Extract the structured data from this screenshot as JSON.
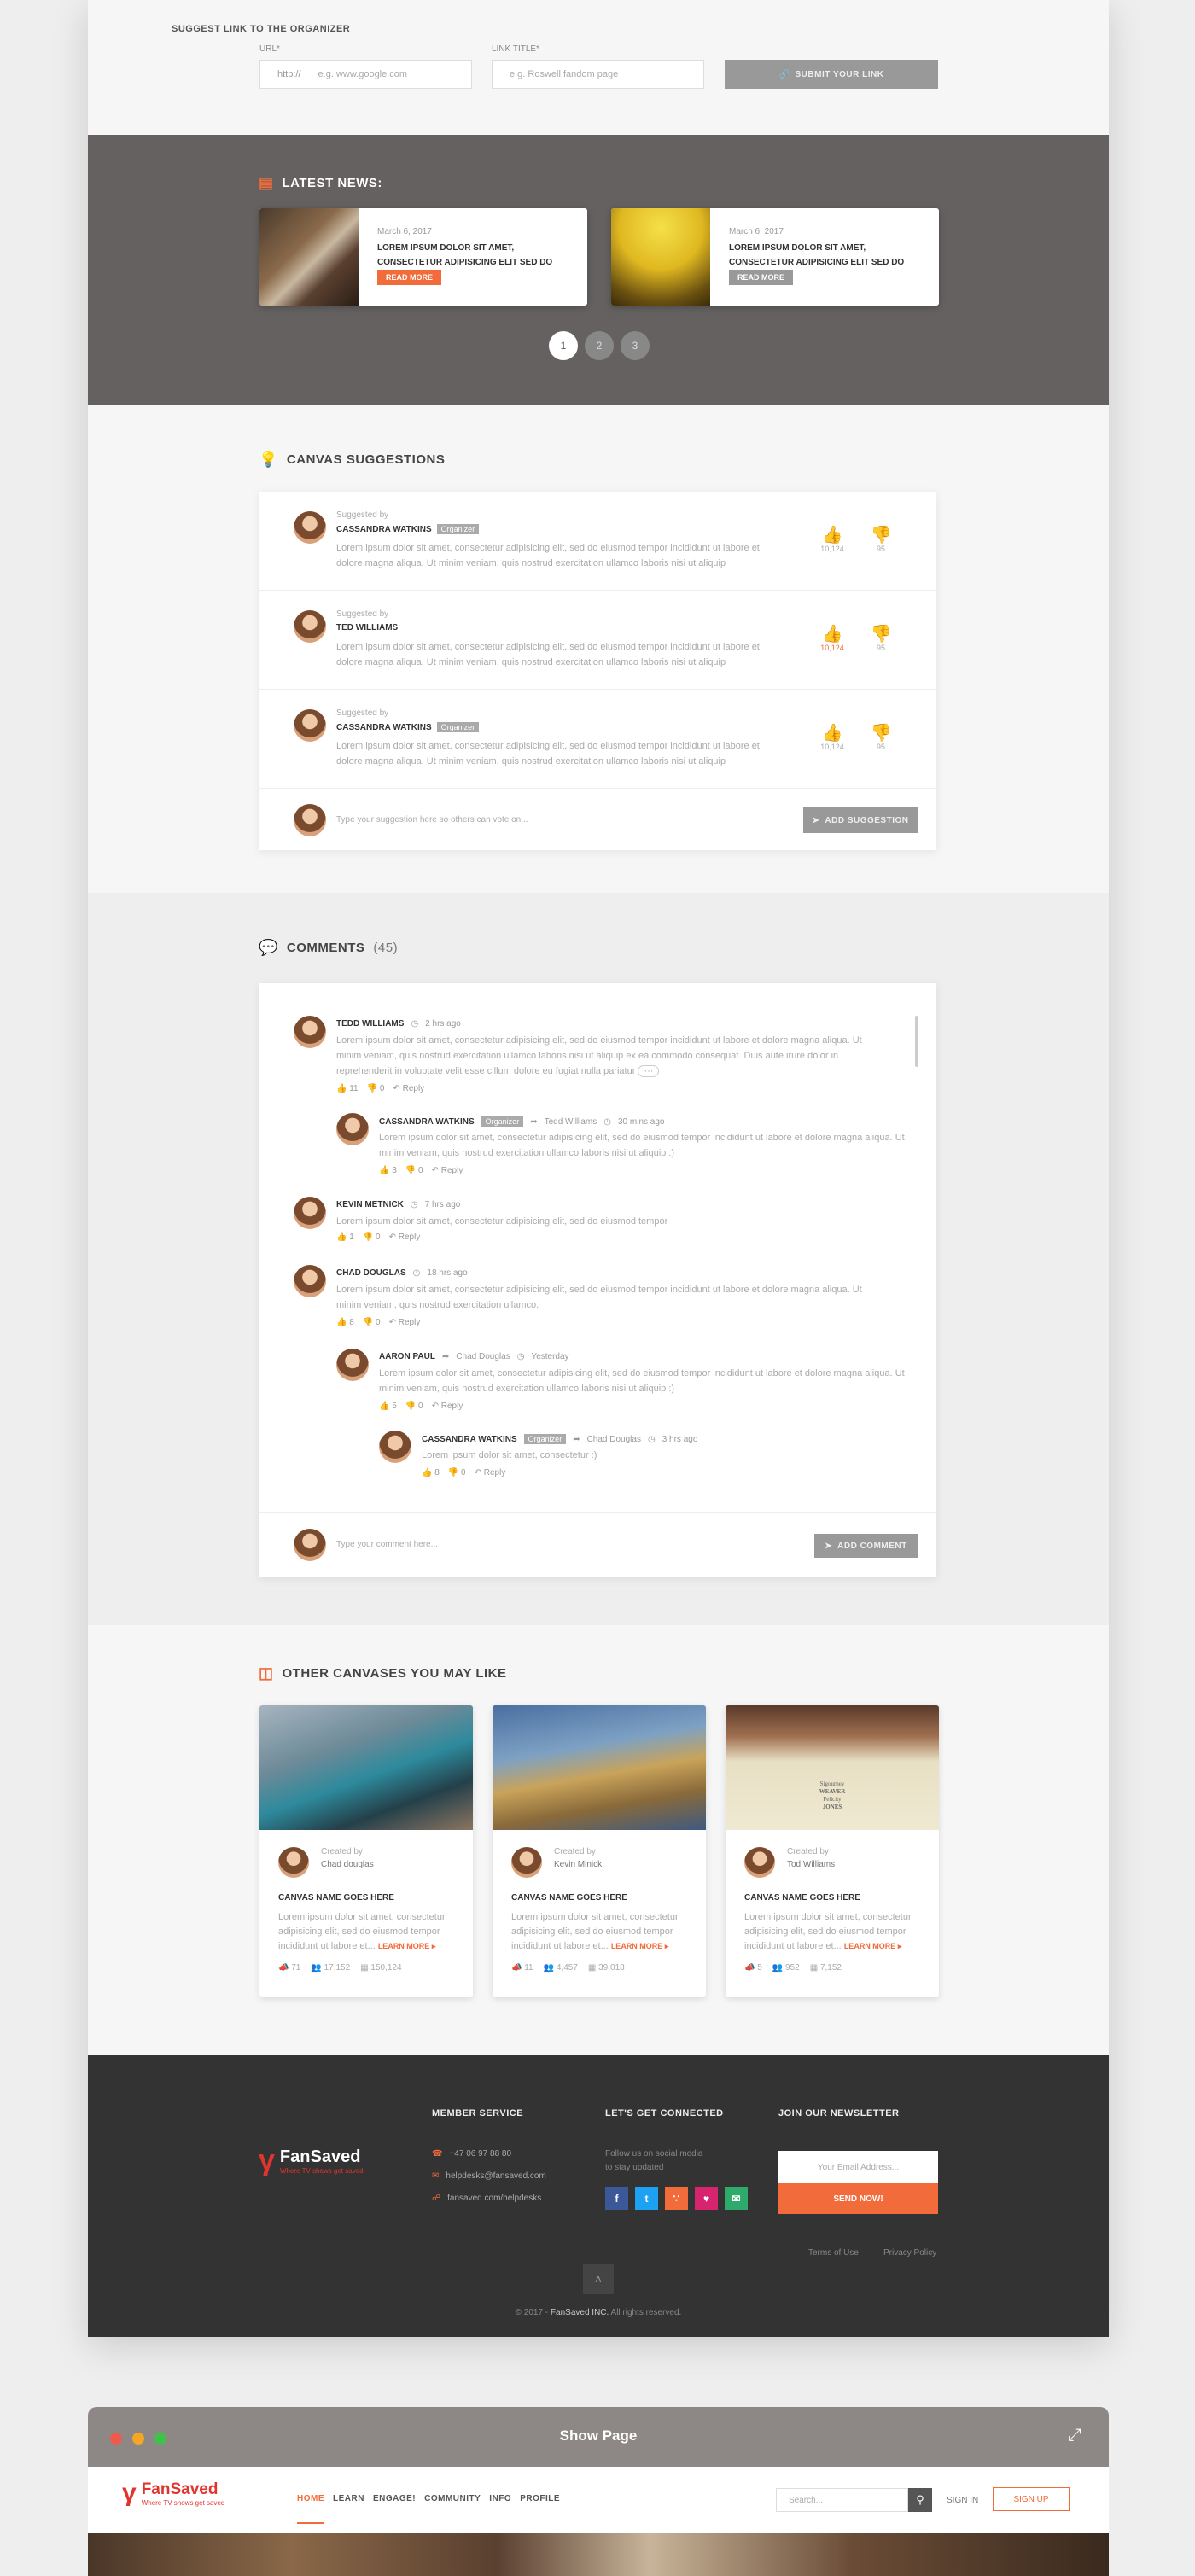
{
  "suggest_link": {
    "title": "SUGGEST LINK TO THE ORGANIZER",
    "url_label": "URL*",
    "url_prefix": "http://",
    "url_placeholder": "e.g. www.google.com",
    "title_label": "LINK TITLE*",
    "title_placeholder": "e.g. Roswell fandom page",
    "submit_label": "SUBMIT YOUR LINK"
  },
  "latest_news": {
    "heading": "LATEST NEWS:",
    "cards": [
      {
        "date": "March 6, 2017",
        "title": "LOREM IPSUM DOLOR SIT AMET, CONSECTETUR ADIPISICING ELIT SED DO",
        "button": "READ MORE",
        "button_color": "#f26b3a"
      },
      {
        "date": "March 6, 2017",
        "title": "LOREM IPSUM DOLOR SIT AMET, CONSECTETUR ADIPISICING ELIT SED DO",
        "button": "READ MORE",
        "button_color": "#999999"
      }
    ],
    "pages": [
      "1",
      "2",
      "3"
    ],
    "active_page": "1"
  },
  "canvas_suggestions": {
    "heading": "CANVAS SUGGESTIONS",
    "items": [
      {
        "suggested_by": "Suggested by",
        "name": "CASSANDRA WATKINS",
        "badge": "Organizer",
        "text": "Lorem ipsum dolor sit amet, consectetur adipisicing elit, sed do eiusmod tempor incididunt ut labore et dolore magna aliqua. Ut minim veniam, quis nostrud exercitation ullamco laboris nisi ut aliquip",
        "up": "10,124",
        "down": "95",
        "up_active": false
      },
      {
        "suggested_by": "Suggested by",
        "name": "TED WILLIAMS",
        "badge": "",
        "text": "Lorem ipsum dolor sit amet, consectetur adipisicing elit, sed do eiusmod tempor incididunt ut labore et dolore magna aliqua. Ut minim veniam, quis nostrud exercitation ullamco laboris nisi ut aliquip",
        "up": "10,124",
        "down": "95",
        "up_active": true
      },
      {
        "suggested_by": "Suggested by",
        "name": "CASSANDRA WATKINS",
        "badge": "Organizer",
        "text": "Lorem ipsum dolor sit amet, consectetur adipisicing elit, sed do eiusmod tempor incididunt ut labore et dolore magna aliqua. Ut minim veniam, quis nostrud exercitation ullamco laboris nisi ut aliquip",
        "up": "10,124",
        "down": "95",
        "up_active": false
      }
    ],
    "input_placeholder": "Type your suggestion here so others can vote on...",
    "add_label": "ADD SUGGESTION"
  },
  "comments": {
    "heading": "COMMENTS",
    "count": "(45)",
    "items": [
      {
        "name": "TEDD WILLIAMS",
        "time": "2 hrs ago",
        "text1": "Lorem ipsum dolor sit amet, consectetur adipisicing elit, sed do eiusmod tempor incididunt ut labore et dolore magna aliqua. Ut",
        "text2": "minim veniam, quis nostrud exercitation ullamco laboris nisi ut aliquip ex ea commodo consequat. Duis aute irure dolor in",
        "text3": "reprehenderit in voluptate velit esse cillum dolore eu fugiat nulla pariatur",
        "up": "11",
        "down": "0",
        "reply": "Reply"
      },
      {
        "name": "CASSANDRA WATKINS",
        "badge": "Organizer",
        "to": "Tedd Williams",
        "time": "30 mins ago",
        "text1": "Lorem ipsum dolor sit amet, consectetur adipisicing elit, sed do eiusmod tempor incididunt ut labore et dolore magna aliqua. Ut",
        "text2": "minim veniam, quis nostrud exercitation ullamco laboris nisi ut aliquip :)",
        "up": "3",
        "down": "0",
        "reply": "Reply"
      },
      {
        "name": "KEVIN METNICK",
        "time": "7 hrs ago",
        "text1": "Lorem ipsum dolor sit amet, consectetur adipisicing elit, sed do eiusmod tempor",
        "up": "1",
        "down": "0",
        "reply": "Reply"
      },
      {
        "name": "CHAD DOUGLAS",
        "time": "18 hrs ago",
        "text1": "Lorem ipsum dolor sit amet, consectetur adipisicing elit, sed do eiusmod tempor incididunt ut labore et dolore magna aliqua. Ut",
        "text2": "minim veniam, quis nostrud exercitation ullamco.",
        "up": "8",
        "down": "0",
        "reply": "Reply"
      },
      {
        "name": "AARON PAUL",
        "to": "Chad Douglas",
        "time": "Yesterday",
        "text1": "Lorem ipsum dolor sit amet, consectetur adipisicing elit, sed do eiusmod tempor incididunt ut labore et dolore magna aliqua. Ut",
        "text2": "minim veniam, quis nostrud exercitation ullamco laboris nisi ut aliquip :)",
        "up": "5",
        "down": "0",
        "reply": "Reply"
      },
      {
        "name": "CASSANDRA WATKINS",
        "badge": "Organizer",
        "to": "Chad Douglas",
        "time": "3 hrs ago",
        "text1": "Lorem ipsum dolor sit amet, consectetur :)",
        "up": "8",
        "down": "0",
        "reply": "Reply"
      }
    ],
    "input_placeholder": "Type your comment here...",
    "add_label": "ADD COMMENT"
  },
  "other_canvases": {
    "heading": "OTHER CANVASES YOU MAY LIKE",
    "items": [
      {
        "created_by": "Created by",
        "creator": "Chad douglas",
        "title": "CANVAS NAME GOES HERE",
        "desc": "Lorem ipsum dolor sit amet, consectetur adipisicing elit, sed do eiusmod tempor incididunt ut labore et...",
        "learn": "LEARN MORE",
        "s1": "71",
        "s2": "17,152",
        "s3": "150,124"
      },
      {
        "created_by": "Created by",
        "creator": "Kevin Minick",
        "title": "CANVAS NAME GOES HERE",
        "desc": "Lorem ipsum dolor sit amet, consectetur adipisicing elit, sed do eiusmod tempor incididunt ut labore et...",
        "learn": "LEARN MORE",
        "s1": "11",
        "s2": "4,457",
        "s3": "39,018"
      },
      {
        "created_by": "Created by",
        "creator": "Tod Williams",
        "title": "CANVAS NAME GOES HERE",
        "desc": "Lorem ipsum dolor sit amet, consectetur adipisicing elit, sed do eiusmod tempor incididunt ut labore et...",
        "learn": "LEARN MORE",
        "s1": "5",
        "s2": "952",
        "s3": "7,152"
      }
    ],
    "poster_lines": [
      "Sigourney",
      "WEAVER",
      "Felicity",
      "JONES"
    ]
  },
  "footer": {
    "brand": "FanSaved",
    "tagline": "Where TV shows get saved",
    "member_service": "MEMBER SERVICE",
    "phone": "+47 06 97 88 80",
    "email": "helpdesks@fansaved.com",
    "help": "fansaved.com/helpdesks",
    "connected": "LET'S GET CONNECTED",
    "follow": "Follow us on social media",
    "follow2": "to stay updated",
    "newsletter": "JOIN OUR NEWSLETTER",
    "email_placeholder": "Your Email Address...",
    "send": "SEND NOW!",
    "terms": "Terms of Use",
    "privacy": "Privacy Policy",
    "copy_pre": "© 2017 - ",
    "copy_brand": "FanSaved INC.",
    "copy_post": " All rights reserved."
  },
  "show_page": {
    "title": "Show Page",
    "nav": [
      "HOME",
      "LEARN",
      "ENGAGE!",
      "COMMUNITY",
      "INFO",
      "PROFILE"
    ],
    "search_placeholder": "Search...",
    "sign_in": "SIGN IN",
    "sign_up": "SIGN UP"
  },
  "colors": {
    "accent": "#f26b3a",
    "dark": "#333333",
    "news_band": "#646160"
  }
}
